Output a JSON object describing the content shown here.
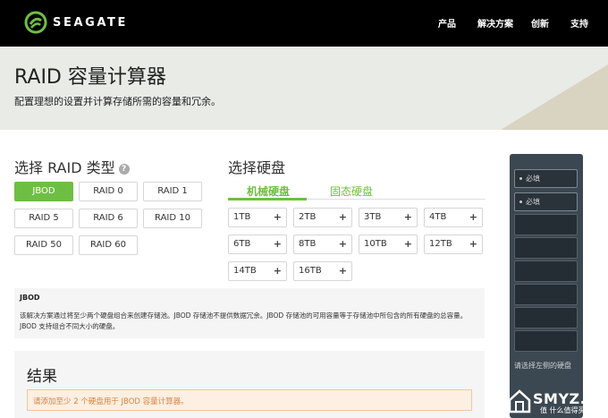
{
  "header": {
    "brand": "SEAGATE",
    "nav": [
      "产品",
      "解决方案",
      "创新",
      "支持"
    ]
  },
  "hero": {
    "title": "RAID 容量计算器",
    "subtitle": "配置理想的设置并计算存储所需的容量和冗余。"
  },
  "raid": {
    "title": "选择 RAID 类型",
    "help": "?",
    "types": [
      "JBOD",
      "RAID 0",
      "RAID 1",
      "RAID 5",
      "RAID 6",
      "RAID 10",
      "RAID 50",
      "RAID 60"
    ],
    "selected": "JBOD"
  },
  "drives": {
    "title": "选择硬盘",
    "tabs": [
      "机械硬盘",
      "固态硬盘"
    ],
    "active_tab": "机械硬盘",
    "sizes": [
      "1TB",
      "2TB",
      "3TB",
      "4TB",
      "6TB",
      "8TB",
      "10TB",
      "12TB",
      "14TB",
      "16TB"
    ],
    "add_symbol": "+"
  },
  "description": {
    "title": "JBOD",
    "text": "该解决方案通过将至少两个硬盘组合来创建存储池。JBOD 存储池不提供数据冗余。JBOD 存储池的可用容量等于存储池中所包含的所有硬盘的总容量。JBOD 支持组合不同大小的硬盘。"
  },
  "result": {
    "title": "结果",
    "message": "请添加至少 2 个硬盘用于 JBOD 容量计算器。"
  },
  "nas": {
    "slots": [
      "必填",
      "必填",
      "",
      "",
      "",
      "",
      "",
      ""
    ],
    "footer": "请选择左侧的硬盘"
  },
  "watermark": {
    "text": "SMYZ.NET",
    "sub": "值 什么值得买"
  },
  "colors": {
    "accent": "#6ebe44",
    "header_bg": "#000000",
    "hero_bg": "#e9ebe7",
    "alert_bg": "#fdefe2",
    "alert_text": "#d9823b",
    "nas_bg": "#3c4851"
  }
}
